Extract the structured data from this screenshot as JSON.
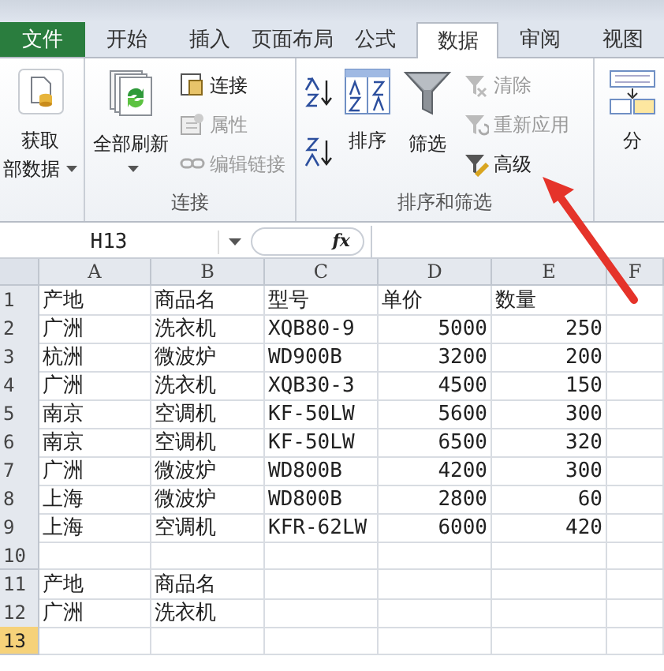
{
  "tabs": [
    {
      "label": "文件",
      "kind": "file",
      "selected": false
    },
    {
      "label": "开始",
      "kind": "tab",
      "selected": false
    },
    {
      "label": "插入",
      "kind": "tab",
      "selected": false
    },
    {
      "label": "页面布局",
      "kind": "tab",
      "selected": false
    },
    {
      "label": "公式",
      "kind": "tab",
      "selected": false
    },
    {
      "label": "数据",
      "kind": "tab",
      "selected": true
    },
    {
      "label": "审阅",
      "kind": "tab",
      "selected": false
    },
    {
      "label": "视图",
      "kind": "tab",
      "selected": false
    }
  ],
  "ribbon": {
    "groups": [
      {
        "buttons": [
          {
            "lines": [
              "获取",
              "部数据"
            ],
            "dropdown": true,
            "disabled": false
          }
        ]
      },
      {
        "label": "连接",
        "buttons": [
          {
            "lines": [
              "全部刷新"
            ],
            "dropdown": true,
            "disabled": false
          },
          {
            "lines": [
              "连接"
            ],
            "disabled": false
          },
          {
            "lines": [
              "属性"
            ],
            "disabled": true
          },
          {
            "lines": [
              "编辑链接"
            ],
            "disabled": true
          }
        ]
      },
      {
        "label": "排序和筛选",
        "buttons": [
          {
            "lines": [
              "排序"
            ],
            "disabled": false
          },
          {
            "lines": [
              "筛选"
            ],
            "disabled": false
          },
          {
            "lines": [
              "清除"
            ],
            "disabled": true
          },
          {
            "lines": [
              "重新应用"
            ],
            "disabled": true
          },
          {
            "lines": [
              "高级"
            ],
            "disabled": false
          }
        ]
      },
      {
        "buttons": [
          {
            "lines": [
              "分"
            ],
            "disabled": false
          }
        ]
      }
    ]
  },
  "formula_bar": {
    "name_box": "H13",
    "function_label": "fx"
  },
  "sheet": {
    "columns": [
      "A",
      "B",
      "C",
      "D",
      "E",
      "F"
    ],
    "rows": [
      {
        "header": "1",
        "selected": false,
        "cells": [
          {
            "text": "产地",
            "kind": "text"
          },
          {
            "text": "商品名",
            "kind": "text"
          },
          {
            "text": "型号",
            "kind": "text"
          },
          {
            "text": "单价",
            "kind": "text"
          },
          {
            "text": "数量",
            "kind": "text"
          }
        ]
      },
      {
        "header": "2",
        "selected": false,
        "cells": [
          {
            "text": "广洲",
            "kind": "text"
          },
          {
            "text": "洗衣机",
            "kind": "text"
          },
          {
            "text": "XQB80-9",
            "kind": "text"
          },
          {
            "text": "5000",
            "kind": "number"
          },
          {
            "text": "250",
            "kind": "number"
          }
        ]
      },
      {
        "header": "3",
        "selected": false,
        "cells": [
          {
            "text": "杭洲",
            "kind": "text"
          },
          {
            "text": "微波炉",
            "kind": "text"
          },
          {
            "text": "WD900B",
            "kind": "text"
          },
          {
            "text": "3200",
            "kind": "number"
          },
          {
            "text": "200",
            "kind": "number"
          }
        ]
      },
      {
        "header": "4",
        "selected": false,
        "cells": [
          {
            "text": "广洲",
            "kind": "text"
          },
          {
            "text": "洗衣机",
            "kind": "text"
          },
          {
            "text": "XQB30-3",
            "kind": "text"
          },
          {
            "text": "4500",
            "kind": "number"
          },
          {
            "text": "150",
            "kind": "number"
          }
        ]
      },
      {
        "header": "5",
        "selected": false,
        "cells": [
          {
            "text": "南京",
            "kind": "text"
          },
          {
            "text": "空调机",
            "kind": "text"
          },
          {
            "text": "KF-50LW",
            "kind": "text"
          },
          {
            "text": "5600",
            "kind": "number"
          },
          {
            "text": "300",
            "kind": "number"
          }
        ]
      },
      {
        "header": "6",
        "selected": false,
        "cells": [
          {
            "text": "南京",
            "kind": "text"
          },
          {
            "text": "空调机",
            "kind": "text"
          },
          {
            "text": "KF-50LW",
            "kind": "text"
          },
          {
            "text": "6500",
            "kind": "number"
          },
          {
            "text": "320",
            "kind": "number"
          }
        ]
      },
      {
        "header": "7",
        "selected": false,
        "cells": [
          {
            "text": "广洲",
            "kind": "text"
          },
          {
            "text": "微波炉",
            "kind": "text"
          },
          {
            "text": "WD800B",
            "kind": "text"
          },
          {
            "text": "4200",
            "kind": "number"
          },
          {
            "text": "300",
            "kind": "number"
          }
        ]
      },
      {
        "header": "8",
        "selected": false,
        "cells": [
          {
            "text": "上海",
            "kind": "text"
          },
          {
            "text": "微波炉",
            "kind": "text"
          },
          {
            "text": "WD800B",
            "kind": "text"
          },
          {
            "text": "2800",
            "kind": "number"
          },
          {
            "text": "60",
            "kind": "number"
          }
        ]
      },
      {
        "header": "9",
        "selected": false,
        "cells": [
          {
            "text": "上海",
            "kind": "text"
          },
          {
            "text": "空调机",
            "kind": "text"
          },
          {
            "text": "KFR-62LW",
            "kind": "text"
          },
          {
            "text": "6000",
            "kind": "number"
          },
          {
            "text": "420",
            "kind": "number"
          }
        ]
      },
      {
        "header": "10",
        "selected": false
      },
      {
        "header": "11",
        "selected": false,
        "cells": [
          {
            "text": "产地",
            "kind": "text"
          },
          {
            "text": "商品名",
            "kind": "text"
          }
        ]
      },
      {
        "header": "12",
        "selected": false,
        "cells": [
          {
            "text": "广洲",
            "kind": "text"
          },
          {
            "text": "洗衣机",
            "kind": "text"
          }
        ]
      },
      {
        "header": "13",
        "selected": true
      }
    ]
  }
}
